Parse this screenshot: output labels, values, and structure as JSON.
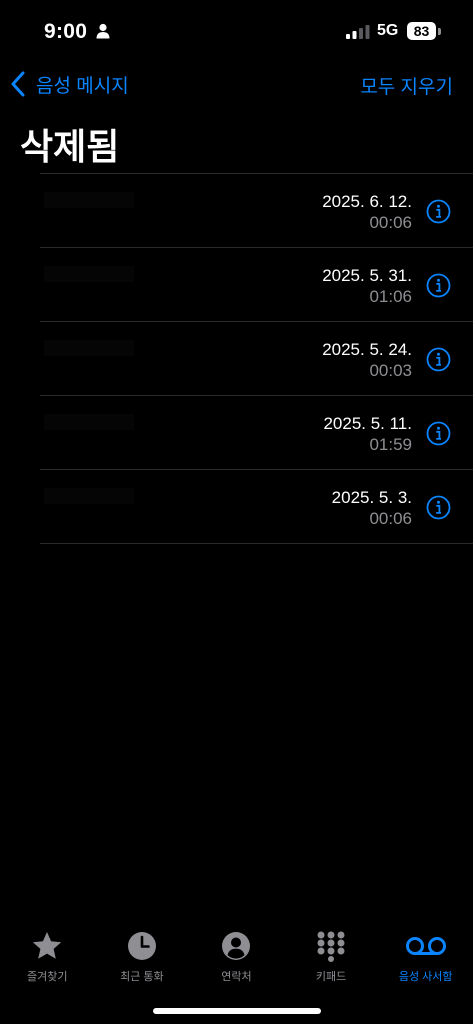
{
  "status_bar": {
    "time": "9:00",
    "network": "5G",
    "battery": "83"
  },
  "nav": {
    "back_label": "음성 메시지",
    "action_label": "모두 지우기"
  },
  "title": "삭제됨",
  "items": [
    {
      "name": "",
      "date": "2025. 6. 12.",
      "duration": "00:06"
    },
    {
      "name": "",
      "date": "2025. 5. 31.",
      "duration": "01:06"
    },
    {
      "name": "",
      "date": "2025. 5. 24.",
      "duration": "00:03"
    },
    {
      "name": "",
      "date": "2025. 5. 11.",
      "duration": "01:59"
    },
    {
      "name": "",
      "date": "2025. 5. 3.",
      "duration": "00:06"
    }
  ],
  "tabs": [
    {
      "label": "즐겨찾기",
      "icon": "star-icon",
      "active": false
    },
    {
      "label": "최근 통화",
      "icon": "clock-icon",
      "active": false
    },
    {
      "label": "연락처",
      "icon": "contact-icon",
      "active": false
    },
    {
      "label": "키패드",
      "icon": "keypad-icon",
      "active": false
    },
    {
      "label": "음성 사서함",
      "icon": "voicemail-icon",
      "active": true
    }
  ],
  "colors": {
    "accent": "#0a84ff",
    "secondary_text": "#8e8e93",
    "background": "#000000"
  }
}
